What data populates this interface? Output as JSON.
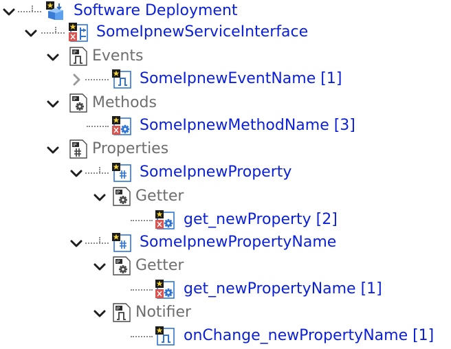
{
  "tree": {
    "colors": {
      "element_text": "#0a1fd6",
      "folder_text": "#6e6e6e"
    },
    "nodes": [
      {
        "label": "Software Deployment",
        "kind": "element",
        "icon": "software-deployment-icon",
        "expander": "expanded"
      },
      {
        "label": "SomeIpnewServiceInterface",
        "kind": "element",
        "icon": "service-interface-icon",
        "expander": "expanded"
      },
      {
        "label": "Events",
        "kind": "folder",
        "icon": "events-folder-icon",
        "expander": "expanded"
      },
      {
        "label": "SomeIpnewEventName [1]",
        "kind": "element",
        "icon": "event-icon",
        "expander": "collapsed"
      },
      {
        "label": "Methods",
        "kind": "folder",
        "icon": "methods-folder-icon",
        "expander": "expanded"
      },
      {
        "label": "SomeIpnewMethodName [3]",
        "kind": "element",
        "icon": "method-icon",
        "expander": "none"
      },
      {
        "label": "Properties",
        "kind": "folder",
        "icon": "properties-folder-icon",
        "expander": "expanded"
      },
      {
        "label": "SomeIpnewProperty",
        "kind": "element",
        "icon": "property-icon",
        "expander": "expanded"
      },
      {
        "label": "Getter",
        "kind": "folder",
        "icon": "getter-folder-icon",
        "expander": "expanded"
      },
      {
        "label": "get_newProperty [2]",
        "kind": "element",
        "icon": "method-icon",
        "expander": "none"
      },
      {
        "label": "SomeIpnewPropertyName",
        "kind": "element",
        "icon": "property-icon",
        "expander": "expanded"
      },
      {
        "label": "Getter",
        "kind": "folder",
        "icon": "getter-folder-icon",
        "expander": "expanded"
      },
      {
        "label": "get_newPropertyName [1]",
        "kind": "element",
        "icon": "method-icon",
        "expander": "none"
      },
      {
        "label": "Notifier",
        "kind": "folder",
        "icon": "notifier-folder-icon",
        "expander": "expanded"
      },
      {
        "label": "onChange_newPropertyName [1]",
        "kind": "element",
        "icon": "event-icon",
        "expander": "none"
      }
    ]
  }
}
